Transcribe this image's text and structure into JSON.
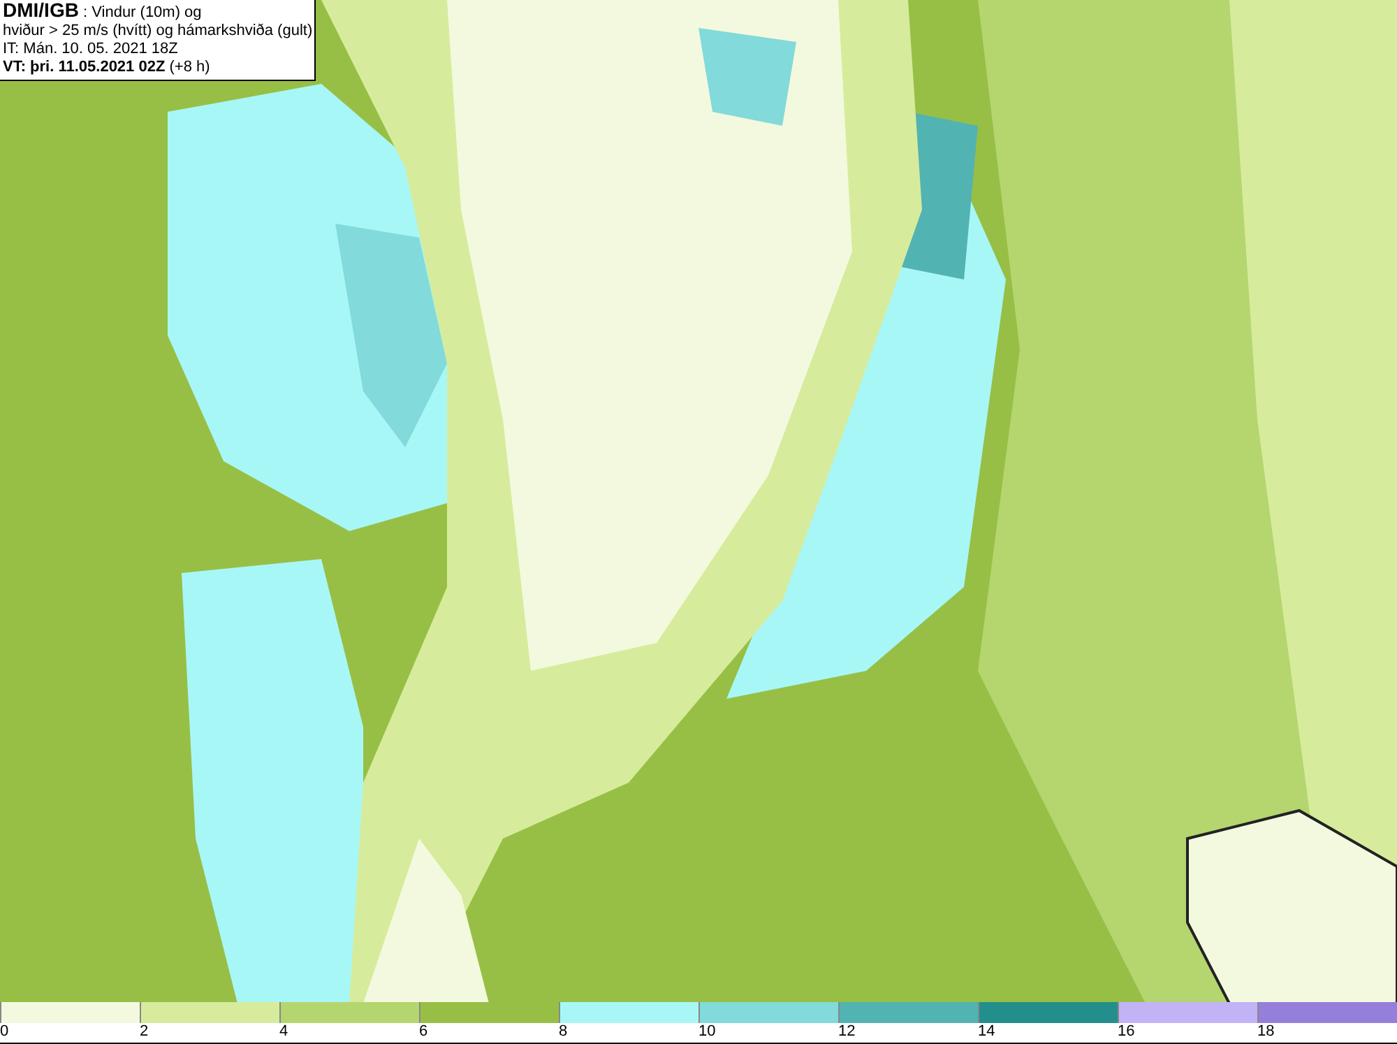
{
  "header": {
    "lines": [
      "**DMI/IGB** : Vindur (10m) og",
      "hviður > 25 m/s (hvítt) og hámarkshviða (gult)",
      "IT: Mán. 10. 05. 2021 18Z",
      "**VT: þri. 11.05.2021 02Z** (+8 h)"
    ]
  },
  "legend": {
    "bins": [
      {
        "color": "#f3f9de",
        "tick": "0"
      },
      {
        "color": "#d6ec9c",
        "tick": "2"
      },
      {
        "color": "#b5d56f",
        "tick": "4"
      },
      {
        "color": "#97bf45",
        "tick": "6"
      },
      {
        "color": "#a8f7f7",
        "tick": "8"
      },
      {
        "color": "#82dada",
        "tick": "10"
      },
      {
        "color": "#52b3b3",
        "tick": "12"
      },
      {
        "color": "#238f8c",
        "tick": "14"
      },
      {
        "color": "#c2b3f7",
        "tick": "16"
      },
      {
        "color": "#967fdb",
        "tick": "18"
      }
    ]
  }
}
